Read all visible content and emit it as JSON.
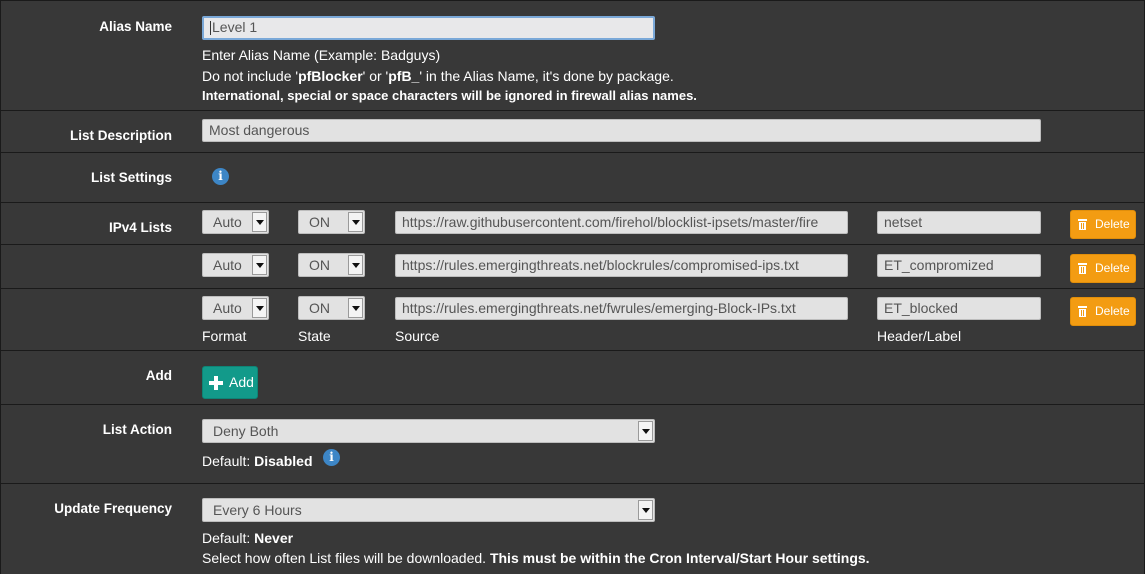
{
  "alias_name": {
    "label": "Alias Name",
    "value": "Level 1",
    "help1": "Enter Alias Name (Example: Badguys)",
    "help2_pre": "Do not include '",
    "help2_b1": "pfBlocker",
    "help2_mid": "' or '",
    "help2_b2": "pfB_",
    "help2_post": "' in the Alias Name, it's done by package.",
    "help3": "International, special or space characters will be ignored in firewall alias names."
  },
  "list_description": {
    "label": "List Description",
    "value": "Most dangerous"
  },
  "list_settings": {
    "label": "List Settings",
    "info_icon": "i"
  },
  "ipv4_lists": {
    "label": "IPv4 Lists",
    "rows": [
      {
        "format": "Auto",
        "state": "ON",
        "source": "https://raw.githubusercontent.com/firehol/blocklist-ipsets/master/fire",
        "header": "netset",
        "delete_label": "Delete"
      },
      {
        "format": "Auto",
        "state": "ON",
        "source": "https://rules.emergingthreats.net/blockrules/compromised-ips.txt",
        "header": "ET_compromized",
        "delete_label": "Delete"
      },
      {
        "format": "Auto",
        "state": "ON",
        "source": "https://rules.emergingthreats.net/fwrules/emerging-Block-IPs.txt",
        "header": "ET_blocked",
        "delete_label": "Delete"
      }
    ],
    "columns": {
      "format": "Format",
      "state": "State",
      "source": "Source",
      "header": "Header/Label"
    }
  },
  "add": {
    "label": "Add",
    "button_label": "Add"
  },
  "list_action": {
    "label": "List Action",
    "value": "Deny Both",
    "default_prefix": "Default: ",
    "default_value": "Disabled",
    "info_icon": "i"
  },
  "update_frequency": {
    "label": "Update Frequency",
    "value": "Every 6 Hours",
    "default_prefix": "Default: ",
    "default_value": "Never",
    "help_pre": "Select how often List files will be downloaded. ",
    "help_bold": "This must be within the Cron Interval/Start Hour settings."
  },
  "colors": {
    "panel": "#383838",
    "delete": "#f39c12",
    "add": "#129a8a",
    "info": "#3d86c6"
  }
}
